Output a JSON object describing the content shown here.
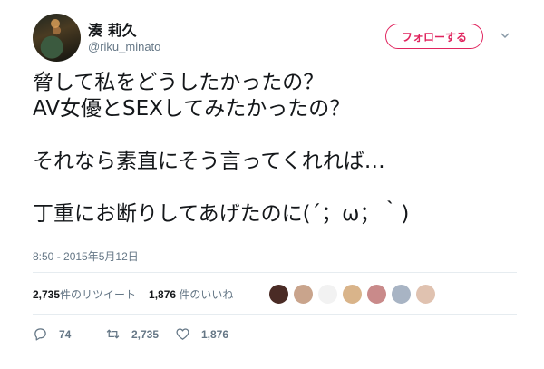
{
  "user": {
    "display_name": "湊 莉久",
    "screen_name": "@riku_minato"
  },
  "follow_button": {
    "label": "フォローする"
  },
  "tweet": {
    "lines": [
      "脅して私をどうしたかったの？",
      "AV女優とSEXしてみたかったの？",
      "",
      "それなら素直にそう言ってくれれば…",
      "",
      "丁重にお断りしてあげたのに(´；ω；｀)"
    ],
    "timestamp": "8:50 - 2015年5月12日"
  },
  "stats": {
    "retweets_count": "2,735",
    "retweets_label": "件のリツイート",
    "likes_count": "1,876",
    "likes_label": "件のいいね"
  },
  "likers": {
    "colors": [
      "#4a2b25",
      "#c9a48c",
      "#f2f2f2",
      "#d9b48a",
      "#c98a8a",
      "#a8b4c4",
      "#e0c2b0"
    ]
  },
  "actions": {
    "reply_count": "74",
    "retweet_count": "2,735",
    "like_count": "1,876"
  },
  "colors": {
    "accent": "#e0245e",
    "secondary_text": "#657786"
  }
}
